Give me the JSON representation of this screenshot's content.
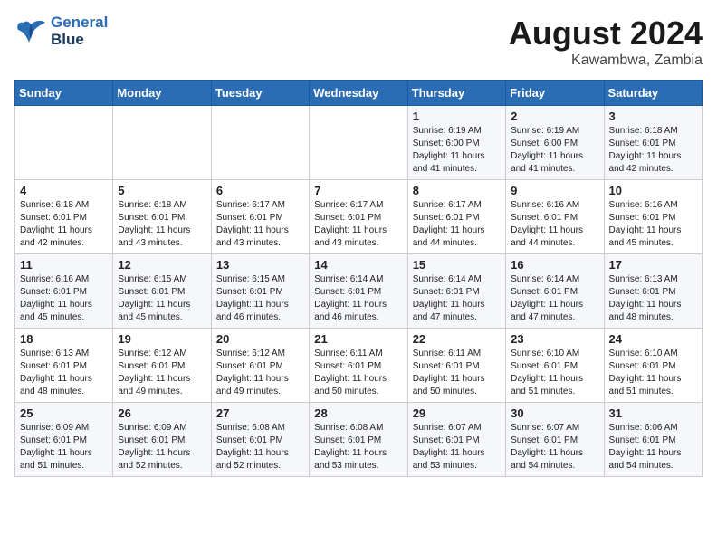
{
  "header": {
    "logo_line1": "General",
    "logo_line2": "Blue",
    "title": "August 2024",
    "subtitle": "Kawambwa, Zambia"
  },
  "weekdays": [
    "Sunday",
    "Monday",
    "Tuesday",
    "Wednesday",
    "Thursday",
    "Friday",
    "Saturday"
  ],
  "weeks": [
    [
      {
        "day": "",
        "info": ""
      },
      {
        "day": "",
        "info": ""
      },
      {
        "day": "",
        "info": ""
      },
      {
        "day": "",
        "info": ""
      },
      {
        "day": "1",
        "info": "Sunrise: 6:19 AM\nSunset: 6:00 PM\nDaylight: 11 hours\nand 41 minutes."
      },
      {
        "day": "2",
        "info": "Sunrise: 6:19 AM\nSunset: 6:00 PM\nDaylight: 11 hours\nand 41 minutes."
      },
      {
        "day": "3",
        "info": "Sunrise: 6:18 AM\nSunset: 6:01 PM\nDaylight: 11 hours\nand 42 minutes."
      }
    ],
    [
      {
        "day": "4",
        "info": "Sunrise: 6:18 AM\nSunset: 6:01 PM\nDaylight: 11 hours\nand 42 minutes."
      },
      {
        "day": "5",
        "info": "Sunrise: 6:18 AM\nSunset: 6:01 PM\nDaylight: 11 hours\nand 43 minutes."
      },
      {
        "day": "6",
        "info": "Sunrise: 6:17 AM\nSunset: 6:01 PM\nDaylight: 11 hours\nand 43 minutes."
      },
      {
        "day": "7",
        "info": "Sunrise: 6:17 AM\nSunset: 6:01 PM\nDaylight: 11 hours\nand 43 minutes."
      },
      {
        "day": "8",
        "info": "Sunrise: 6:17 AM\nSunset: 6:01 PM\nDaylight: 11 hours\nand 44 minutes."
      },
      {
        "day": "9",
        "info": "Sunrise: 6:16 AM\nSunset: 6:01 PM\nDaylight: 11 hours\nand 44 minutes."
      },
      {
        "day": "10",
        "info": "Sunrise: 6:16 AM\nSunset: 6:01 PM\nDaylight: 11 hours\nand 45 minutes."
      }
    ],
    [
      {
        "day": "11",
        "info": "Sunrise: 6:16 AM\nSunset: 6:01 PM\nDaylight: 11 hours\nand 45 minutes."
      },
      {
        "day": "12",
        "info": "Sunrise: 6:15 AM\nSunset: 6:01 PM\nDaylight: 11 hours\nand 45 minutes."
      },
      {
        "day": "13",
        "info": "Sunrise: 6:15 AM\nSunset: 6:01 PM\nDaylight: 11 hours\nand 46 minutes."
      },
      {
        "day": "14",
        "info": "Sunrise: 6:14 AM\nSunset: 6:01 PM\nDaylight: 11 hours\nand 46 minutes."
      },
      {
        "day": "15",
        "info": "Sunrise: 6:14 AM\nSunset: 6:01 PM\nDaylight: 11 hours\nand 47 minutes."
      },
      {
        "day": "16",
        "info": "Sunrise: 6:14 AM\nSunset: 6:01 PM\nDaylight: 11 hours\nand 47 minutes."
      },
      {
        "day": "17",
        "info": "Sunrise: 6:13 AM\nSunset: 6:01 PM\nDaylight: 11 hours\nand 48 minutes."
      }
    ],
    [
      {
        "day": "18",
        "info": "Sunrise: 6:13 AM\nSunset: 6:01 PM\nDaylight: 11 hours\nand 48 minutes."
      },
      {
        "day": "19",
        "info": "Sunrise: 6:12 AM\nSunset: 6:01 PM\nDaylight: 11 hours\nand 49 minutes."
      },
      {
        "day": "20",
        "info": "Sunrise: 6:12 AM\nSunset: 6:01 PM\nDaylight: 11 hours\nand 49 minutes."
      },
      {
        "day": "21",
        "info": "Sunrise: 6:11 AM\nSunset: 6:01 PM\nDaylight: 11 hours\nand 50 minutes."
      },
      {
        "day": "22",
        "info": "Sunrise: 6:11 AM\nSunset: 6:01 PM\nDaylight: 11 hours\nand 50 minutes."
      },
      {
        "day": "23",
        "info": "Sunrise: 6:10 AM\nSunset: 6:01 PM\nDaylight: 11 hours\nand 51 minutes."
      },
      {
        "day": "24",
        "info": "Sunrise: 6:10 AM\nSunset: 6:01 PM\nDaylight: 11 hours\nand 51 minutes."
      }
    ],
    [
      {
        "day": "25",
        "info": "Sunrise: 6:09 AM\nSunset: 6:01 PM\nDaylight: 11 hours\nand 51 minutes."
      },
      {
        "day": "26",
        "info": "Sunrise: 6:09 AM\nSunset: 6:01 PM\nDaylight: 11 hours\nand 52 minutes."
      },
      {
        "day": "27",
        "info": "Sunrise: 6:08 AM\nSunset: 6:01 PM\nDaylight: 11 hours\nand 52 minutes."
      },
      {
        "day": "28",
        "info": "Sunrise: 6:08 AM\nSunset: 6:01 PM\nDaylight: 11 hours\nand 53 minutes."
      },
      {
        "day": "29",
        "info": "Sunrise: 6:07 AM\nSunset: 6:01 PM\nDaylight: 11 hours\nand 53 minutes."
      },
      {
        "day": "30",
        "info": "Sunrise: 6:07 AM\nSunset: 6:01 PM\nDaylight: 11 hours\nand 54 minutes."
      },
      {
        "day": "31",
        "info": "Sunrise: 6:06 AM\nSunset: 6:01 PM\nDaylight: 11 hours\nand 54 minutes."
      }
    ]
  ]
}
